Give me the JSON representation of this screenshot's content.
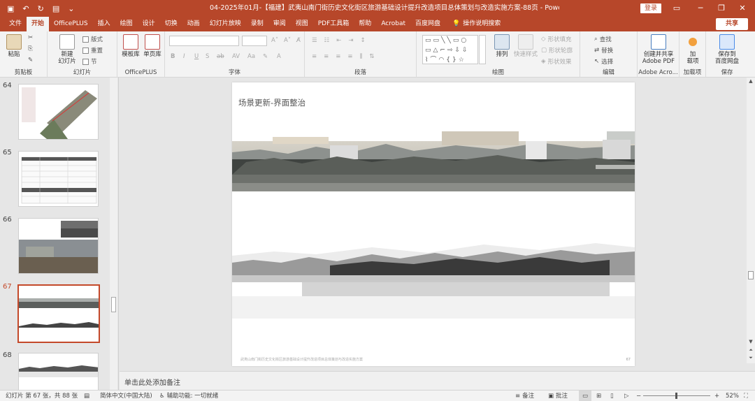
{
  "window": {
    "title": "04-2025年01月-【福建】武夷山南门街历史文化街区旅游基础设计提升改造项目总体策划与改造实施方案-88页  -  PowerPoint",
    "login_label": "登录"
  },
  "tabs": [
    "文件",
    "开始",
    "OfficePLUS",
    "插入",
    "绘图",
    "设计",
    "切换",
    "动画",
    "幻灯片放映",
    "录制",
    "审阅",
    "视图",
    "PDF工具箱",
    "帮助",
    "Acrobat",
    "百度网盘"
  ],
  "active_tab": "开始",
  "tell_me": "操作说明搜索",
  "share_label": "共享",
  "ribbon": {
    "clipboard": {
      "label": "剪贴板",
      "paste": "粘贴"
    },
    "slides": {
      "label": "幻灯片",
      "new_slide": "新建\n幻灯片",
      "layout": "版式",
      "reset": "重置",
      "section": "节"
    },
    "officeplus": {
      "label": "OfficePLUS",
      "template": "模板库",
      "single": "单页库"
    },
    "font": {
      "label": "字体"
    },
    "paragraph": {
      "label": "段落"
    },
    "drawing": {
      "label": "绘图",
      "arrange": "排列",
      "quick_styles": "快速样式",
      "fill": "形状填充",
      "outline": "形状轮廓",
      "effects": "形状效果"
    },
    "editing": {
      "label": "编辑",
      "find": "查找",
      "replace": "替换",
      "select": "选择"
    },
    "adobe": {
      "label": "Adobe Acro...",
      "create_share": "创建并共享\nAdobe PDF"
    },
    "addins": {
      "label": "加载项",
      "addins_btn": "加\n载项"
    },
    "save": {
      "label": "保存",
      "save_baidu": "保存到\n百度网盘"
    }
  },
  "thumbnails": [
    {
      "num": "64"
    },
    {
      "num": "65"
    },
    {
      "num": "66"
    },
    {
      "num": "67"
    },
    {
      "num": "68"
    }
  ],
  "active_slide": "67",
  "slide": {
    "title": "场景更新-界面整治",
    "footer": "武夷山南门街历史文化街区旅游基础设计提升改造项目总体策划与改造实施方案",
    "page": "67"
  },
  "notes_placeholder": "单击此处添加备注",
  "status": {
    "slide_info": "幻灯片 第 67 张，共 88 张",
    "language": "简体中文(中国大陆)",
    "accessibility": "辅助功能: 一切就绪",
    "notes": "备注",
    "comments": "批注",
    "zoom": "52%"
  },
  "colors": {
    "accent": "#b7472a",
    "active_thumb": "#c4492a"
  }
}
